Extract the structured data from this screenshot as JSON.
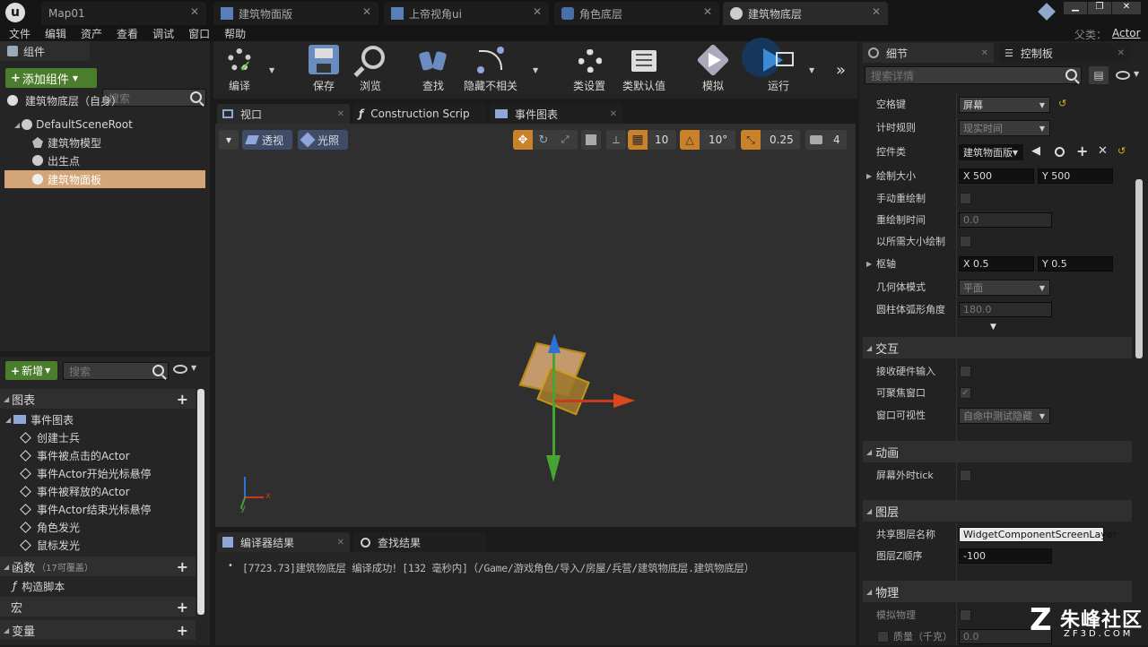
{
  "tabs": [
    {
      "label": "Map01",
      "active": false
    },
    {
      "label": "建筑物面版",
      "active": false
    },
    {
      "label": "上帝视角ui",
      "active": false
    },
    {
      "label": "角色底层",
      "active": false
    },
    {
      "label": "建筑物底层",
      "active": true
    }
  ],
  "menu": [
    "文件",
    "编辑",
    "资产",
    "查看",
    "调试",
    "窗口",
    "帮助"
  ],
  "parent_label": "父类：",
  "parent_value": "Actor",
  "components": {
    "tab": "组件",
    "add_button": "添加组件",
    "search_placeholder": "搜索",
    "self": "建筑物底层（自身）",
    "items": [
      "DefaultSceneRoot",
      "建筑物模型",
      "出生点",
      "建筑物面板"
    ]
  },
  "mybp": {
    "new_button": "新增",
    "search_placeholder": "搜索",
    "graph_header": "图表",
    "event_graph": "事件图表",
    "events": [
      "创建士兵",
      "事件被点击的Actor",
      "事件Actor开始光标悬停",
      "事件被释放的Actor",
      "事件Actor结束光标悬停",
      "角色发光",
      "鼠标发光"
    ],
    "functions_header": "函数",
    "functions_note": "（17可覆盖）",
    "construct": "构造脚本",
    "macro_header": "宏",
    "variables_header": "变量"
  },
  "toolbar": [
    "编译",
    "保存",
    "浏览",
    "查找",
    "隐藏不相关",
    "类设置",
    "类默认值",
    "模拟",
    "运行"
  ],
  "editor_tabs": [
    "视口",
    "Construction Scrip",
    "事件图表"
  ],
  "viewport": {
    "perspective": "透视",
    "lit": "光照",
    "grid_snap": "10",
    "rot_snap": "10°",
    "scale_snap": "0.25",
    "cam_speed": "4"
  },
  "bottom_tabs": [
    "编译器结果",
    "查找结果"
  ],
  "log_line": "[7723.73]建筑物底层 编译成功！[132 毫秒内]（/Game/游戏角色/导入/房屋/兵营/建筑物底层.建筑物底层）",
  "details": {
    "tab1": "细节",
    "tab2": "控制板",
    "search_placeholder": "搜索详情",
    "rows": {
      "space": {
        "label": "空格键",
        "value": "屏幕"
      },
      "timing": {
        "label": "计时规则",
        "value": "现实时间"
      },
      "widget_class": {
        "label": "控件类",
        "value": "建筑物面版"
      },
      "draw_size": {
        "label": "绘制大小",
        "x": "X  500",
        "y": "Y  500"
      },
      "manual_redraw": {
        "label": "手动重绘制"
      },
      "redraw_time": {
        "label": "重绘制时间",
        "value": "0.0"
      },
      "draw_desired": {
        "label": "以所需大小绘制"
      },
      "pivot": {
        "label": "枢轴",
        "x": "X  0.5",
        "y": "Y  0.5"
      },
      "geometry": {
        "label": "几何体模式",
        "value": "平面"
      },
      "cylinder": {
        "label": "圆柱体弧形角度",
        "value": "180.0"
      }
    },
    "sections": {
      "interaction": "交互",
      "animation": "动画",
      "layers": "图层",
      "physics": "物理"
    },
    "interaction_rows": {
      "receive_hw": "接收硬件输入",
      "focusable": "可聚焦窗口",
      "window_vis": "窗口可视性",
      "window_vis_value": "自命中测试隐藏"
    },
    "anim_row": "屏幕外时tick",
    "layer_rows": {
      "shared_name": "共享图层名称",
      "shared_value": "WidgetComponentScreenLayer",
      "z_order": "图层Z顺序",
      "z_value": "-100"
    },
    "physics_rows": {
      "simulate": "模拟物理",
      "mass": "质量（千克）",
      "mass_value": "0.0"
    }
  },
  "watermark": {
    "main": "朱峰社区",
    "sub": "ZF3D.COM"
  },
  "colors": {
    "green": "#4a7d2c",
    "selection": "#d2a678",
    "orange": "#c9822a"
  }
}
